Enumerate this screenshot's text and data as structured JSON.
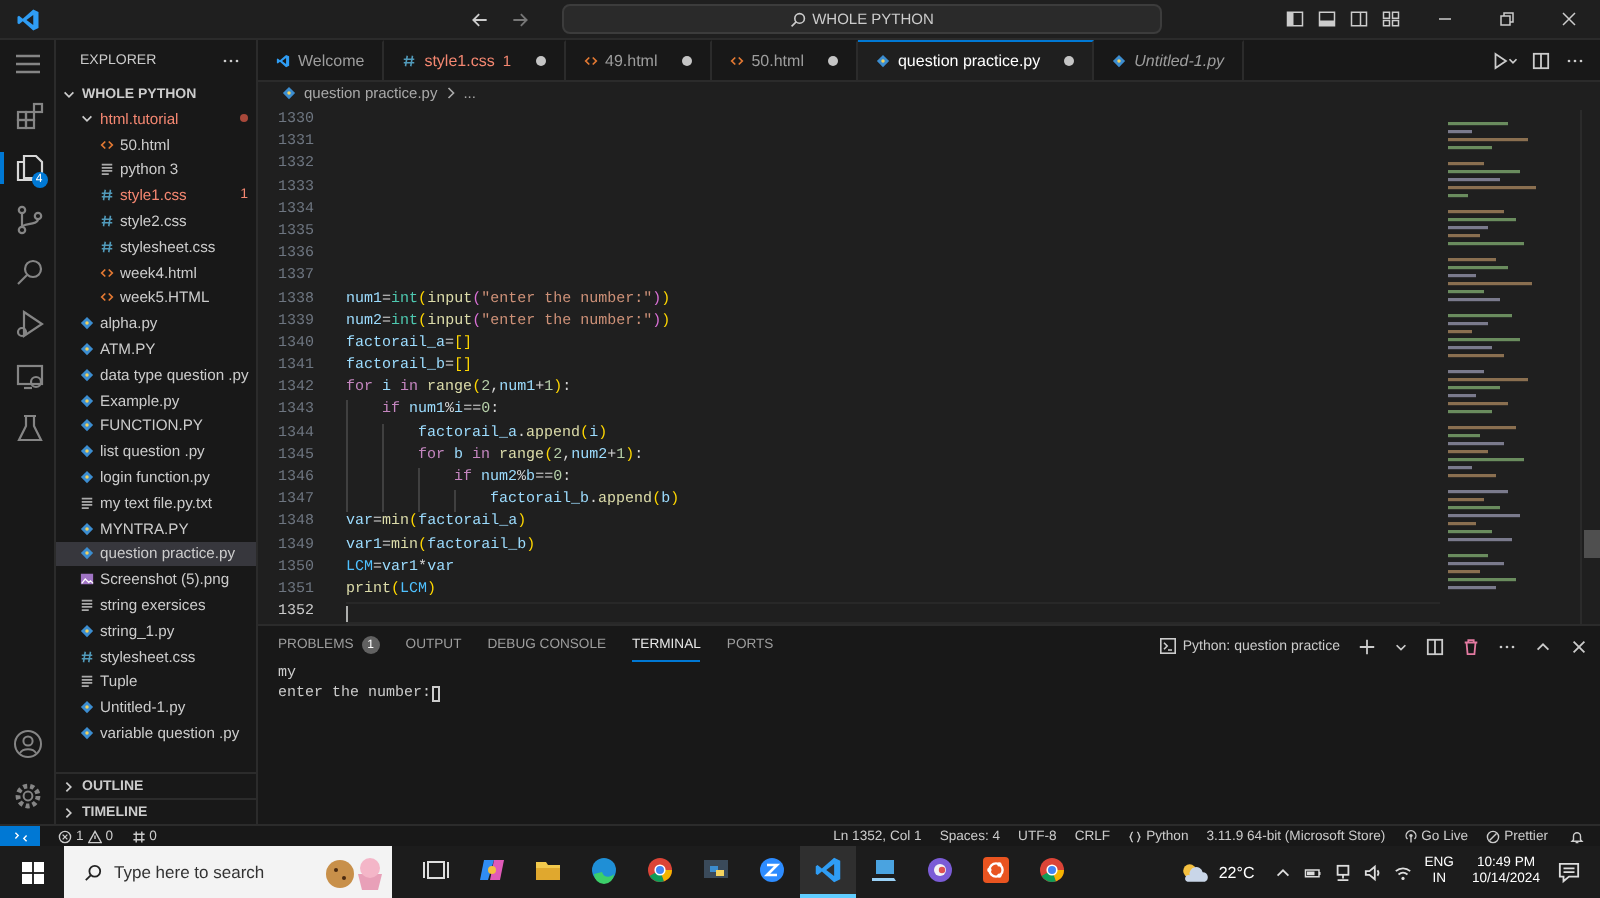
{
  "title_bar": {
    "search": "WHOLE PYTHON"
  },
  "activity_bar": [
    {
      "kind": "extensions",
      "selected": false
    },
    {
      "kind": "explorer",
      "selected": true,
      "badge": "4"
    },
    {
      "kind": "scm",
      "selected": false
    },
    {
      "kind": "search",
      "selected": false
    },
    {
      "kind": "run",
      "selected": false
    },
    {
      "kind": "remote",
      "selected": false
    },
    {
      "kind": "testing",
      "selected": false
    }
  ],
  "sidebar": {
    "title": "EXPLORER",
    "root": "WHOLE PYTHON",
    "items": [
      {
        "label": "html.tutorial",
        "kind": "folder",
        "error": true,
        "modified": true,
        "selected": false,
        "children": [
          {
            "label": "50.html",
            "kind": "html",
            "error": false,
            "selected": false
          },
          {
            "label": "python 3",
            "kind": "txt",
            "error": false,
            "selected": false
          },
          {
            "label": "style1.css",
            "kind": "css",
            "error": true,
            "badge": "1",
            "selected": false
          },
          {
            "label": "style2.css",
            "kind": "css",
            "error": false,
            "selected": false
          },
          {
            "label": "stylesheet.css",
            "kind": "css",
            "error": false,
            "selected": false
          },
          {
            "label": "week4.html",
            "kind": "html",
            "error": false,
            "selected": false
          },
          {
            "label": "week5.HTML",
            "kind": "html",
            "error": false,
            "selected": false
          }
        ]
      },
      {
        "label": "alpha.py",
        "kind": "py",
        "error": false,
        "selected": false
      },
      {
        "label": "ATM.PY",
        "kind": "py",
        "error": false,
        "selected": false
      },
      {
        "label": "data type question  .py",
        "kind": "py",
        "error": false,
        "selected": false
      },
      {
        "label": "Example.py",
        "kind": "py",
        "error": false,
        "selected": false
      },
      {
        "label": "FUNCTION.PY",
        "kind": "py",
        "error": false,
        "selected": false
      },
      {
        "label": "list question .py",
        "kind": "py",
        "error": false,
        "selected": false
      },
      {
        "label": "login  function.py",
        "kind": "py",
        "error": false,
        "selected": false
      },
      {
        "label": "my text file.py.txt",
        "kind": "txt",
        "error": false,
        "selected": false
      },
      {
        "label": "MYNTRA.PY",
        "kind": "py",
        "error": false,
        "selected": false
      },
      {
        "label": "question practice.py",
        "kind": "py",
        "error": false,
        "selected": true
      },
      {
        "label": "Screenshot (5).png",
        "kind": "png",
        "error": false,
        "selected": false
      },
      {
        "label": "string exersices",
        "kind": "txt",
        "error": false,
        "selected": false
      },
      {
        "label": "string_1.py",
        "kind": "py",
        "error": false,
        "selected": false
      },
      {
        "label": "stylesheet.css",
        "kind": "css",
        "error": false,
        "selected": false
      },
      {
        "label": "Tuple",
        "kind": "txt",
        "error": false,
        "selected": false
      },
      {
        "label": "Untitled-1.py",
        "kind": "py",
        "error": false,
        "selected": false
      },
      {
        "label": "variable question .py",
        "kind": "py",
        "error": false,
        "selected": false
      }
    ],
    "sections": [
      "OUTLINE",
      "TIMELINE"
    ]
  },
  "tabs": [
    {
      "label": "Welcome",
      "kind": "vscode",
      "selected": false,
      "modified": false,
      "error": false,
      "preview": false
    },
    {
      "label": "style1.css",
      "kind": "css",
      "badge": "1",
      "selected": false,
      "modified": true,
      "error": true,
      "preview": false
    },
    {
      "label": "49.html",
      "kind": "html",
      "selected": false,
      "modified": true,
      "error": false,
      "preview": false
    },
    {
      "label": "50.html",
      "kind": "html",
      "selected": false,
      "modified": true,
      "error": false,
      "preview": false
    },
    {
      "label": "question practice.py",
      "kind": "py",
      "selected": true,
      "modified": true,
      "error": false,
      "preview": false
    },
    {
      "label": "Untitled-1.py",
      "kind": "py",
      "selected": false,
      "modified": false,
      "error": false,
      "preview": true
    }
  ],
  "breadcrumb": [
    "question practice.py",
    "..."
  ],
  "code": [
    {
      "no": "1330"
    },
    {
      "no": "1331"
    },
    {
      "no": "1332"
    },
    {
      "no": "1333"
    },
    {
      "no": "1334"
    },
    {
      "no": "1335"
    },
    {
      "no": "1336"
    },
    {
      "no": "1337"
    },
    {
      "no": "1338",
      "tokens": [
        {
          "text": "num1",
          "kind": "var"
        },
        {
          "text": "=",
          "kind": "op"
        },
        {
          "text": "int",
          "kind": "class"
        },
        {
          "text": "(",
          "kind": "bracket1"
        },
        {
          "text": "input",
          "kind": "func"
        },
        {
          "text": "(",
          "kind": "bracket2"
        },
        {
          "text": "\"enter the number:\"",
          "kind": "str"
        },
        {
          "text": ")",
          "kind": "bracket2"
        },
        {
          "text": ")",
          "kind": "bracket1"
        }
      ]
    },
    {
      "no": "1339",
      "tokens": [
        {
          "text": "num2",
          "kind": "var"
        },
        {
          "text": "=",
          "kind": "op"
        },
        {
          "text": "int",
          "kind": "class"
        },
        {
          "text": "(",
          "kind": "bracket1"
        },
        {
          "text": "input",
          "kind": "func"
        },
        {
          "text": "(",
          "kind": "bracket2"
        },
        {
          "text": "\"enter the number:\"",
          "kind": "str"
        },
        {
          "text": ")",
          "kind": "bracket2"
        },
        {
          "text": ")",
          "kind": "bracket1"
        }
      ]
    },
    {
      "no": "1340",
      "tokens": [
        {
          "text": "factorail_a",
          "kind": "var"
        },
        {
          "text": "=",
          "kind": "op"
        },
        {
          "text": "[]",
          "kind": "bracket1"
        }
      ]
    },
    {
      "no": "1341",
      "tokens": [
        {
          "text": "factorail_b",
          "kind": "var"
        },
        {
          "text": "=",
          "kind": "op"
        },
        {
          "text": "[]",
          "kind": "bracket1"
        }
      ]
    },
    {
      "no": "1342",
      "tokens": [
        {
          "text": "for ",
          "kind": "keyword"
        },
        {
          "text": "i",
          "kind": "var"
        },
        {
          "text": " in ",
          "kind": "keyword"
        },
        {
          "text": "range",
          "kind": "func"
        },
        {
          "text": "(",
          "kind": "bracket1"
        },
        {
          "text": "2",
          "kind": "num"
        },
        {
          "text": ",",
          "kind": "op"
        },
        {
          "text": "num1",
          "kind": "var"
        },
        {
          "text": "+",
          "kind": "op"
        },
        {
          "text": "1",
          "kind": "num"
        },
        {
          "text": ")",
          "kind": "bracket1"
        },
        {
          "text": ":",
          "kind": "op"
        }
      ]
    },
    {
      "no": "1343",
      "tokens": [
        {
          "text": "    if ",
          "kind": "keyword"
        },
        {
          "text": "num1",
          "kind": "var"
        },
        {
          "text": "%",
          "kind": "op"
        },
        {
          "text": "i",
          "kind": "var"
        },
        {
          "text": "==",
          "kind": "op"
        },
        {
          "text": "0",
          "kind": "num"
        },
        {
          "text": ":",
          "kind": "op"
        }
      ]
    },
    {
      "no": "1344",
      "tokens": [
        {
          "text": "        factorail_a",
          "kind": "var"
        },
        {
          "text": ".",
          "kind": "op"
        },
        {
          "text": "append",
          "kind": "func"
        },
        {
          "text": "(",
          "kind": "bracket1"
        },
        {
          "text": "i",
          "kind": "var"
        },
        {
          "text": ")",
          "kind": "bracket1"
        }
      ]
    },
    {
      "no": "1345",
      "tokens": [
        {
          "text": "        for ",
          "kind": "keyword"
        },
        {
          "text": "b",
          "kind": "var"
        },
        {
          "text": " in ",
          "kind": "keyword"
        },
        {
          "text": "range",
          "kind": "func"
        },
        {
          "text": "(",
          "kind": "bracket1"
        },
        {
          "text": "2",
          "kind": "num"
        },
        {
          "text": ",",
          "kind": "op"
        },
        {
          "text": "num2",
          "kind": "var"
        },
        {
          "text": "+",
          "kind": "op"
        },
        {
          "text": "1",
          "kind": "num"
        },
        {
          "text": ")",
          "kind": "bracket1"
        },
        {
          "text": ":",
          "kind": "op"
        }
      ]
    },
    {
      "no": "1346",
      "tokens": [
        {
          "text": "            if ",
          "kind": "keyword"
        },
        {
          "text": "num2",
          "kind": "var"
        },
        {
          "text": "%",
          "kind": "op"
        },
        {
          "text": "b",
          "kind": "var"
        },
        {
          "text": "==",
          "kind": "op"
        },
        {
          "text": "0",
          "kind": "num"
        },
        {
          "text": ":",
          "kind": "op"
        }
      ]
    },
    {
      "no": "1347",
      "tokens": [
        {
          "text": "                factorail_b",
          "kind": "var"
        },
        {
          "text": ".",
          "kind": "op"
        },
        {
          "text": "append",
          "kind": "func"
        },
        {
          "text": "(",
          "kind": "bracket1"
        },
        {
          "text": "b",
          "kind": "var"
        },
        {
          "text": ")",
          "kind": "bracket1"
        }
      ]
    },
    {
      "no": "1348",
      "tokens": [
        {
          "text": "var",
          "kind": "var"
        },
        {
          "text": "=",
          "kind": "op"
        },
        {
          "text": "min",
          "kind": "func"
        },
        {
          "text": "(",
          "kind": "bracket1"
        },
        {
          "text": "factorail_a",
          "kind": "var"
        },
        {
          "text": ")",
          "kind": "bracket1"
        }
      ]
    },
    {
      "no": "1349",
      "tokens": [
        {
          "text": "var1",
          "kind": "var"
        },
        {
          "text": "=",
          "kind": "op"
        },
        {
          "text": "min",
          "kind": "func"
        },
        {
          "text": "(",
          "kind": "bracket1"
        },
        {
          "text": "factorail_b",
          "kind": "var"
        },
        {
          "text": ")",
          "kind": "bracket1"
        }
      ]
    },
    {
      "no": "1350",
      "tokens": [
        {
          "text": "LCM",
          "kind": "const"
        },
        {
          "text": "=",
          "kind": "op"
        },
        {
          "text": "var1",
          "kind": "var"
        },
        {
          "text": "*",
          "kind": "op"
        },
        {
          "text": "var",
          "kind": "var"
        }
      ]
    },
    {
      "no": "1351",
      "tokens": [
        {
          "text": "print",
          "kind": "func"
        },
        {
          "text": "(",
          "kind": "bracket1"
        },
        {
          "text": "LCM",
          "kind": "const"
        },
        {
          "text": ")",
          "kind": "bracket1"
        }
      ]
    },
    {
      "no": "1352",
      "current": true
    }
  ],
  "panel": {
    "tabs": [
      {
        "label": "PROBLEMS",
        "badge": "1",
        "selected": false
      },
      {
        "label": "OUTPUT",
        "selected": false
      },
      {
        "label": "DEBUG CONSOLE",
        "selected": false
      },
      {
        "label": "TERMINAL",
        "selected": true
      },
      {
        "label": "PORTS",
        "selected": false
      }
    ],
    "terminal_name": "Python: question practice",
    "terminal_lines": [
      "my",
      "enter the number:"
    ]
  },
  "status_bar": {
    "errors": "1",
    "warnings": "0",
    "ports": "0",
    "items": [
      {
        "text": "Ln 1352, Col 1",
        "kind": "plain"
      },
      {
        "text": "Spaces: 4",
        "kind": "plain"
      },
      {
        "text": "UTF-8",
        "kind": "plain"
      },
      {
        "text": "CRLF",
        "kind": "plain"
      },
      {
        "text": "Python",
        "kind": "braces"
      },
      {
        "text": "3.11.9 64-bit (Microsoft Store)",
        "kind": "plain"
      },
      {
        "text": "Go Live",
        "kind": "broadcast"
      },
      {
        "text": "Prettier",
        "kind": "check"
      }
    ]
  },
  "taskbar": {
    "search_placeholder": "Type here to search",
    "apps": [
      {
        "kind": "taskview",
        "active": false
      },
      {
        "kind": "copilot",
        "active": false
      },
      {
        "kind": "folder",
        "active": false
      },
      {
        "kind": "edge",
        "active": false
      },
      {
        "kind": "chrome",
        "active": false
      },
      {
        "kind": "python",
        "active": false
      },
      {
        "kind": "zoom",
        "active": false
      },
      {
        "kind": "vscode",
        "active": true
      },
      {
        "kind": "laptop",
        "active": false
      },
      {
        "kind": "ring",
        "active": false
      },
      {
        "kind": "ubuntu",
        "active": false
      },
      {
        "kind": "chrome",
        "active": false
      }
    ],
    "weather": "22°C",
    "lang": "ENG",
    "region": "IN",
    "time": "10:49 PM",
    "date": "10/14/2024"
  }
}
